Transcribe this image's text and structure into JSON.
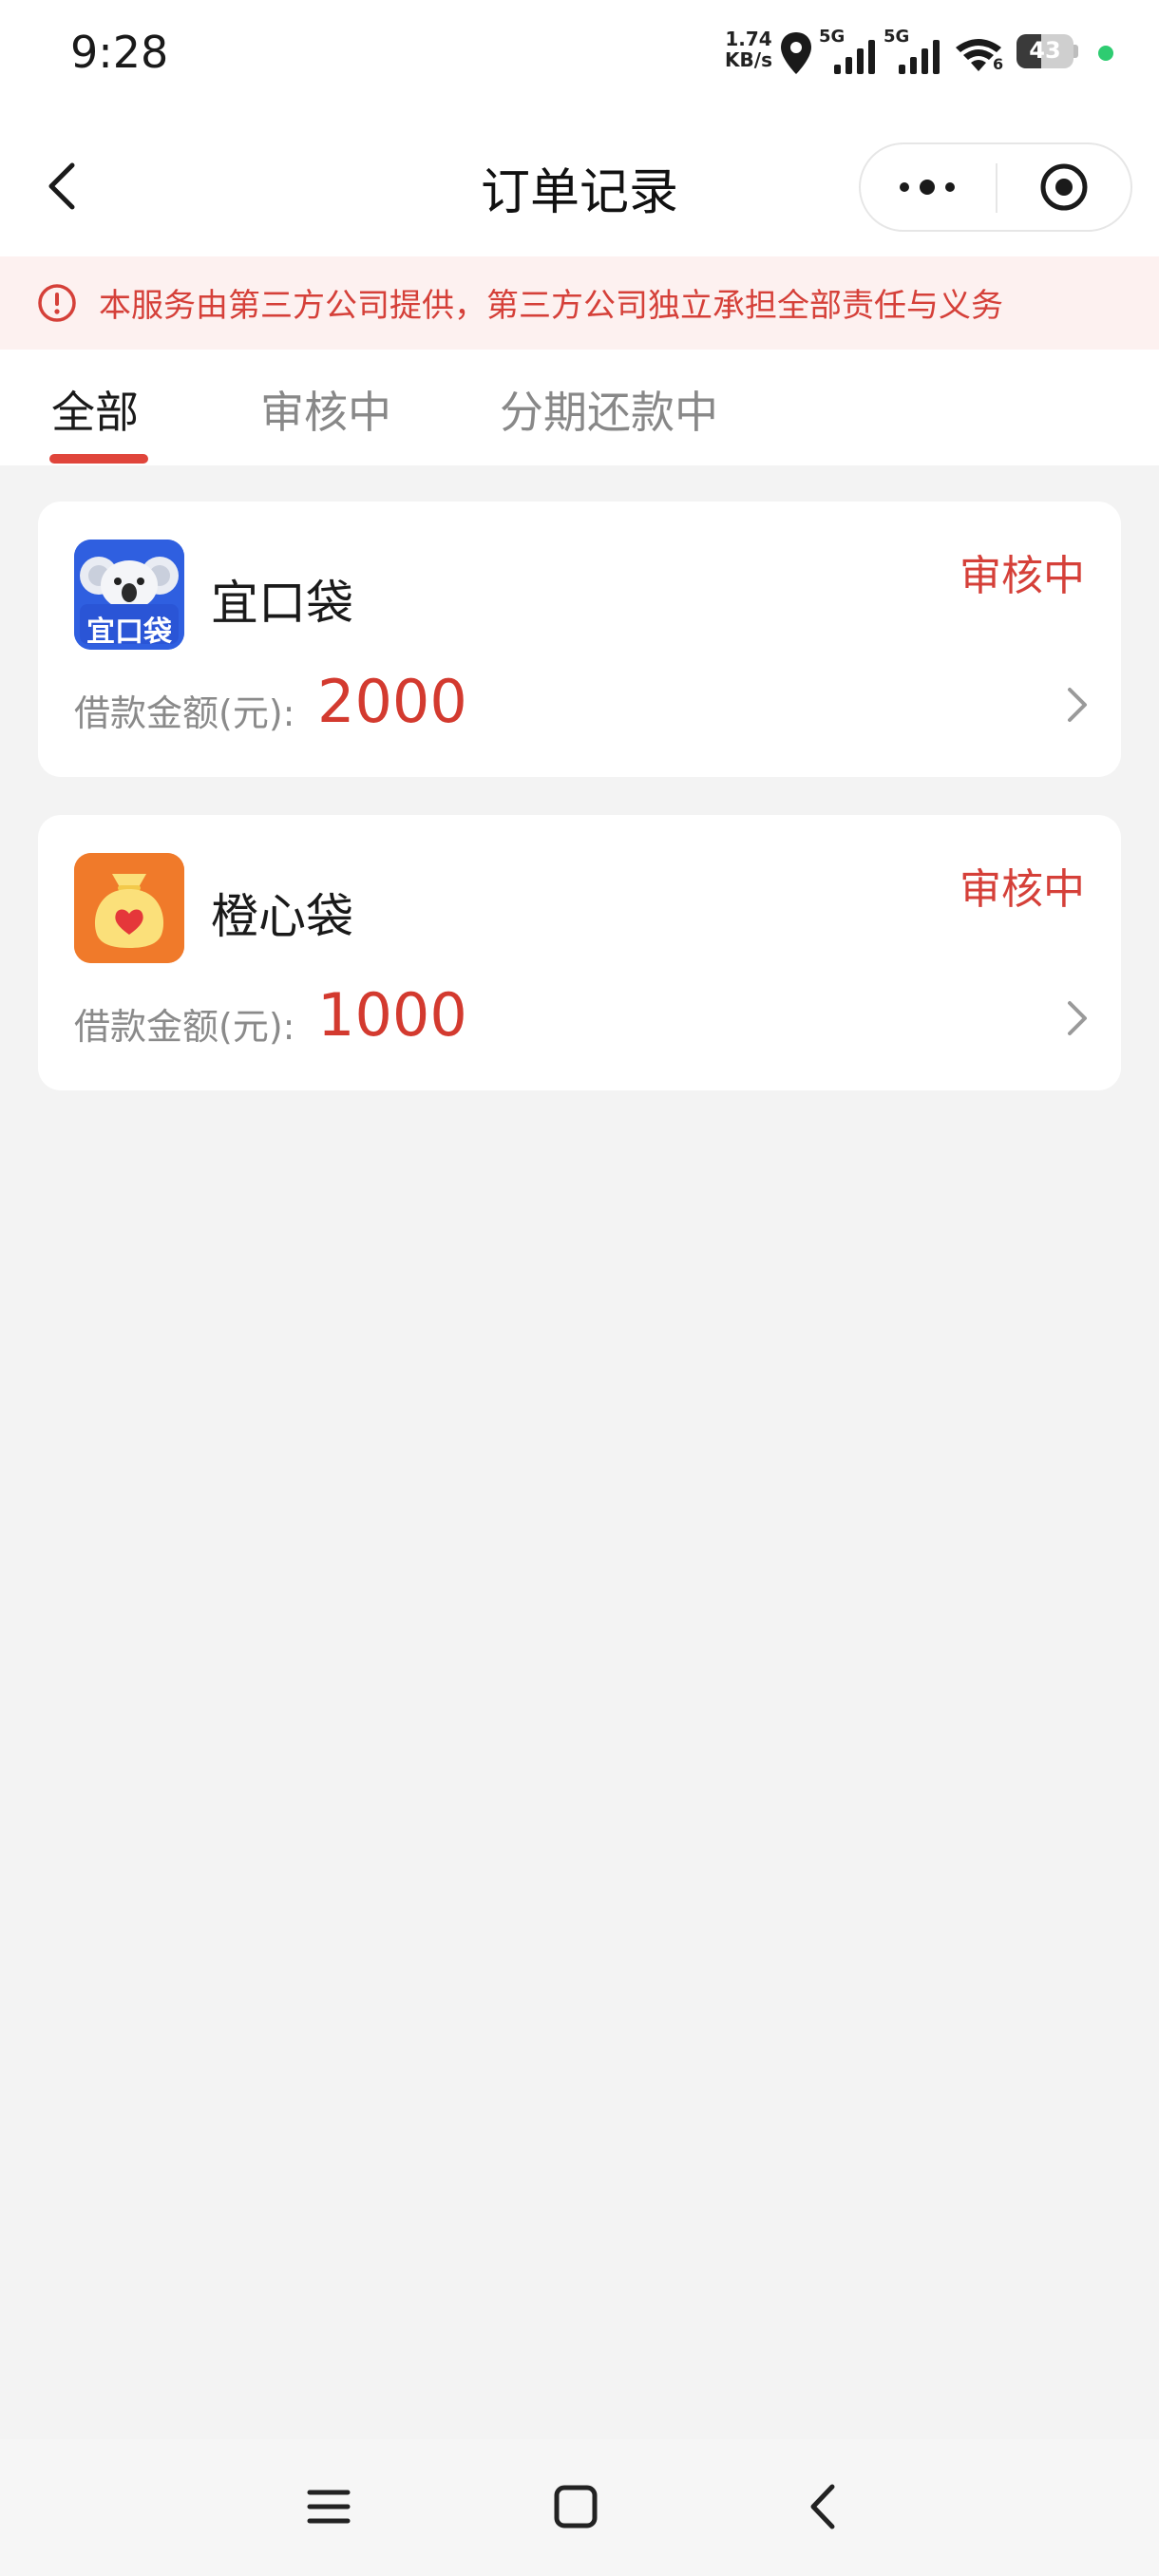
{
  "status_bar": {
    "time": "9:28",
    "speed_value": "1.74",
    "speed_unit": "KB/s",
    "sim1_label": "5G",
    "sim2_label": "5G",
    "wifi_badge": "6",
    "battery_level": "43",
    "icons": [
      "location-icon",
      "signal-icon",
      "signal-icon",
      "wifi-icon",
      "battery-icon"
    ]
  },
  "header": {
    "title": "订单记录",
    "back_icon": "chevron-left-icon",
    "more_icon": "more-dots-icon",
    "target_icon": "target-circle-icon"
  },
  "notice": {
    "text": "本服务由第三方公司提供，第三方公司独立承担全部责任与义务",
    "icon": "alert-circle-icon",
    "color": "#d54039"
  },
  "tabs": [
    {
      "label": "全部",
      "active": true
    },
    {
      "label": "审核中",
      "active": false
    },
    {
      "label": "分期还款中",
      "active": false
    }
  ],
  "orders": [
    {
      "app_name": "宜口袋",
      "logo_text": "宜口袋",
      "logo_icon": "koala-icon",
      "logo_color": "#2f5fe0",
      "status": "审核中",
      "amount_label": "借款金额(元):",
      "amount": "2000"
    },
    {
      "app_name": "橙心袋",
      "logo_icon": "money-bag-heart-icon",
      "logo_color": "#f07a2a",
      "status": "审核中",
      "amount_label": "借款金额(元):",
      "amount": "1000"
    }
  ],
  "nav": {
    "menu_icon": "menu-icon",
    "home_icon": "home-square-icon",
    "back_icon": "back-triangle-icon"
  },
  "colors": {
    "accent": "#e0453b",
    "amount": "#d33a2f",
    "page_bg": "#f3f3f3"
  }
}
